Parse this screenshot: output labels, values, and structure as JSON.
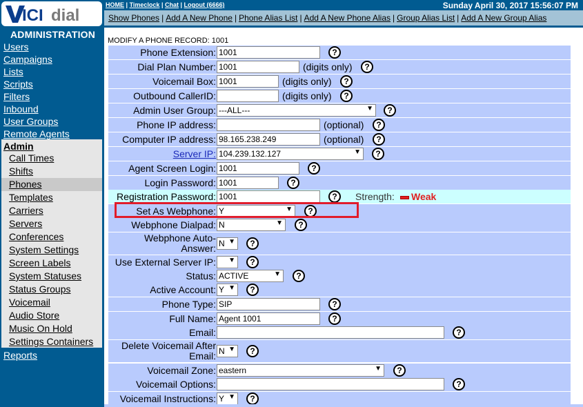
{
  "brand": {
    "logo_text": "VICIdial"
  },
  "sidebar": {
    "heading": "ADMINISTRATION",
    "items": [
      "Users",
      "Campaigns",
      "Lists",
      "Scripts",
      "Filters",
      "Inbound",
      "User Groups",
      "Remote Agents"
    ],
    "admin_label": "Admin",
    "admin_submenu": [
      "Call Times",
      "Shifts",
      "Phones",
      "Templates",
      "Carriers",
      "Servers",
      "Conferences",
      "System Settings",
      "Screen Labels",
      "System Statuses",
      "Status Groups",
      "Voicemail",
      "Audio Store",
      "Music On Hold",
      "Settings Containers"
    ],
    "active_submenu": "Phones",
    "reports_label": "Reports"
  },
  "topbar": {
    "links": [
      "HOME",
      "Timeclock",
      "Chat",
      "Logout (6666)"
    ],
    "separator": "|",
    "datetime": "Sunday April 30, 2017 15:56:07 PM"
  },
  "subnav": {
    "links": [
      "Show Phones",
      "Add A New Phone",
      "Phone Alias List",
      "Add A New Phone Alias",
      "Group Alias List",
      "Add A New Group Alias"
    ],
    "separator": "|"
  },
  "page_title": "MODIFY A PHONE RECORD: 1001",
  "form": {
    "help_glyph": "?",
    "phone_extension": {
      "label": "Phone Extension:",
      "value": "1001"
    },
    "dial_plan_number": {
      "label": "Dial Plan Number:",
      "value": "1001",
      "hint": "(digits only)"
    },
    "voicemail_box": {
      "label": "Voicemail Box:",
      "value": "1001",
      "hint": "(digits only)"
    },
    "outbound_callerid": {
      "label": "Outbound CallerID:",
      "value": "",
      "hint": "(digits only)"
    },
    "admin_user_group": {
      "label": "Admin User Group:",
      "value": "---ALL---"
    },
    "phone_ip": {
      "label": "Phone IP address:",
      "value": "",
      "hint": "(optional)"
    },
    "computer_ip": {
      "label": "Computer IP address:",
      "value": "98.165.238.249",
      "hint": "(optional)"
    },
    "server_ip": {
      "label": "Server IP:",
      "value": "104.239.132.127"
    },
    "agent_screen_login": {
      "label": "Agent Screen Login:",
      "value": "1001"
    },
    "login_password": {
      "label": "Login Password:",
      "value": "1001"
    },
    "registration_password": {
      "label": "Registration Password:",
      "value": "1001",
      "strength_label": "Strength:",
      "strength_value": "Weak"
    },
    "set_as_webphone": {
      "label": "Set As Webphone:",
      "value": "Y"
    },
    "webphone_dialpad": {
      "label": "Webphone Dialpad:",
      "value": "N"
    },
    "webphone_auto_answer": {
      "label": "Webphone Auto-Answer:",
      "value": "N"
    },
    "use_external_server_ip": {
      "label": "Use External Server IP:",
      "value": ""
    },
    "status": {
      "label": "Status:",
      "value": "ACTIVE"
    },
    "active_account": {
      "label": "Active Account:",
      "value": "Y"
    },
    "phone_type": {
      "label": "Phone Type:",
      "value": "SIP"
    },
    "full_name": {
      "label": "Full Name:",
      "value": "Agent 1001"
    },
    "email": {
      "label": "Email:",
      "value": ""
    },
    "delete_voicemail_after_email": {
      "label": "Delete Voicemail After Email:",
      "value": "N"
    },
    "voicemail_zone": {
      "label": "Voicemail Zone:",
      "value": "eastern"
    },
    "voicemail_options": {
      "label": "Voicemail Options:",
      "value": ""
    },
    "voicemail_instructions": {
      "label": "Voicemail Instructions:",
      "value": "Y"
    }
  },
  "colors": {
    "sidebar_bg": "#015b91",
    "row_bg": "#b9cbfd",
    "highlight_row_bg": "#ccffff",
    "highlight_box": "#e11c2b",
    "weak_strength": "#e02020"
  }
}
